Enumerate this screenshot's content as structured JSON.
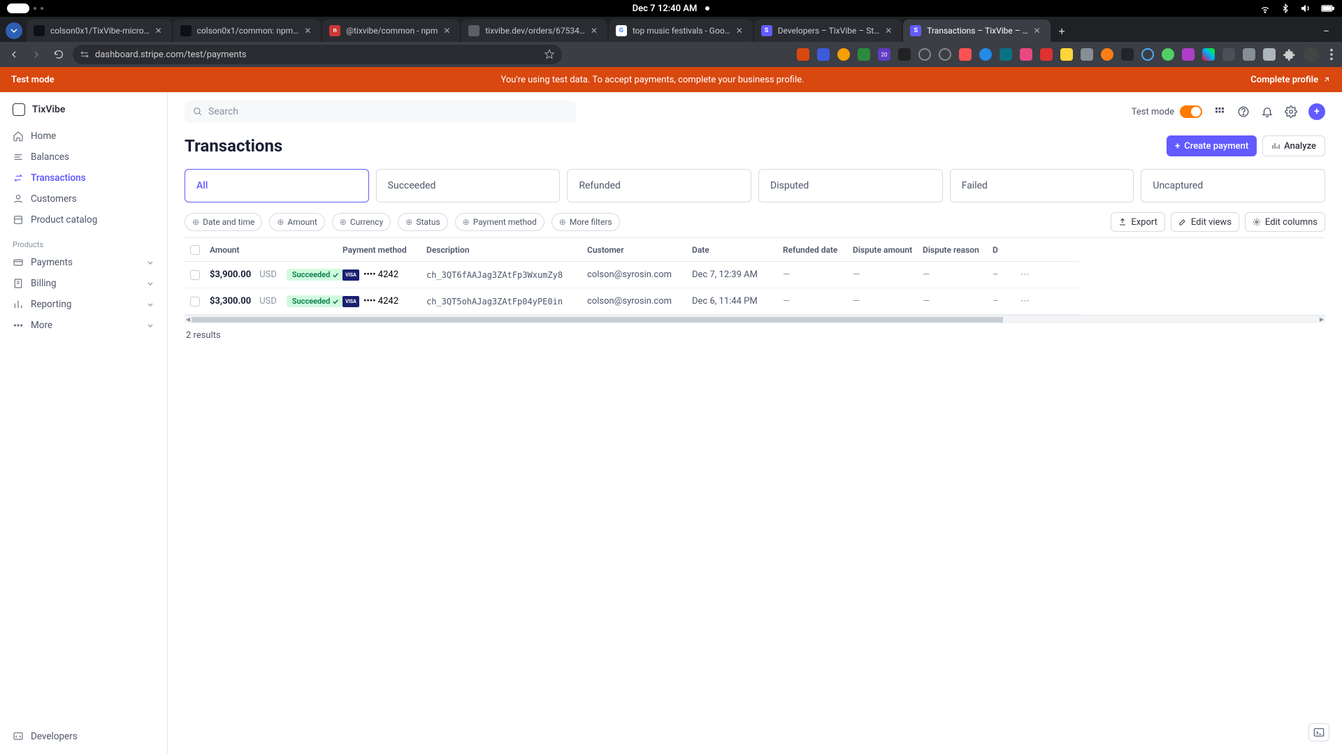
{
  "os": {
    "datetime": "Dec 7  12:40 AM"
  },
  "browser": {
    "url": "dashboard.stripe.com/test/payments",
    "tabs": [
      {
        "title": "colson0x1/TixVibe-micro…",
        "favicon_bg": "#0d1117",
        "favicon_txt": "",
        "favicon_name": "github-icon"
      },
      {
        "title": "colson0x1/common: npm…",
        "favicon_bg": "#0d1117",
        "favicon_txt": "",
        "favicon_name": "github-icon"
      },
      {
        "title": "@tixvibe/common - npm",
        "favicon_bg": "#cb3837",
        "favicon_txt": "n",
        "favicon_name": "npm-icon"
      },
      {
        "title": "tixvibe.dev/orders/67534…",
        "favicon_bg": "#5b5f66",
        "favicon_txt": "",
        "favicon_name": "globe-icon"
      },
      {
        "title": "top music festivals - Goo…",
        "favicon_bg": "#ffffff",
        "favicon_txt": "G",
        "favicon_name": "google-icon"
      },
      {
        "title": "Developers – TixVibe – St…",
        "favicon_bg": "#635bff",
        "favicon_txt": "S",
        "favicon_name": "stripe-icon"
      },
      {
        "title": "Transactions – TixVibe – …",
        "favicon_bg": "#635bff",
        "favicon_txt": "S",
        "favicon_name": "stripe-icon"
      }
    ],
    "active_tab": 6
  },
  "banner": {
    "left": "Test mode",
    "mid": "You're using test data. To accept payments, complete your business profile.",
    "right": "Complete profile"
  },
  "sidebar": {
    "brand": "TixVibe",
    "nav": [
      {
        "label": "Home",
        "icon": "home-icon"
      },
      {
        "label": "Balances",
        "icon": "balances-icon"
      },
      {
        "label": "Transactions",
        "icon": "transactions-icon"
      },
      {
        "label": "Customers",
        "icon": "customers-icon"
      },
      {
        "label": "Product catalog",
        "icon": "catalog-icon"
      }
    ],
    "active_nav": 2,
    "section_label": "Products",
    "products": [
      {
        "label": "Payments",
        "icon": "payments-icon"
      },
      {
        "label": "Billing",
        "icon": "billing-icon"
      },
      {
        "label": "Reporting",
        "icon": "reporting-icon"
      },
      {
        "label": "More",
        "icon": "more-icon"
      }
    ],
    "footer": {
      "label": "Developers",
      "icon": "developers-icon"
    }
  },
  "topbar": {
    "search_placeholder": "Search",
    "test_mode_label": "Test mode"
  },
  "page_title": "Transactions",
  "buttons": {
    "create": "Create payment",
    "analyze": "Analyze",
    "export": "Export",
    "edit_views": "Edit views",
    "edit_columns": "Edit columns"
  },
  "status_tabs": [
    "All",
    "Succeeded",
    "Refunded",
    "Disputed",
    "Failed",
    "Uncaptured"
  ],
  "active_status_tab": 0,
  "filters": [
    "Date and time",
    "Amount",
    "Currency",
    "Status",
    "Payment method",
    "More filters"
  ],
  "table": {
    "headers": [
      "",
      "Amount",
      "Payment method",
      "Description",
      "Customer",
      "Date",
      "Refunded date",
      "Dispute amount",
      "Dispute reason",
      "D"
    ],
    "rows": [
      {
        "amount": "$3,900.00",
        "currency": "USD",
        "status": "Succeeded",
        "card_brand": "VISA",
        "card_last4": "•••• 4242",
        "description": "ch_3QT6fAAJag3ZAtFp3WxumZy8",
        "customer": "colson@syrosin.com",
        "date": "Dec 7, 12:39 AM",
        "refunded_date": "—",
        "dispute_amount": "—",
        "dispute_reason": "—"
      },
      {
        "amount": "$3,300.00",
        "currency": "USD",
        "status": "Succeeded",
        "card_brand": "VISA",
        "card_last4": "•••• 4242",
        "description": "ch_3QT5ohAJag3ZAtFp04yPE0in",
        "customer": "colson@syrosin.com",
        "date": "Dec 6, 11:44 PM",
        "refunded_date": "—",
        "dispute_amount": "—",
        "dispute_reason": "—"
      }
    ],
    "results_text": "2 results"
  }
}
